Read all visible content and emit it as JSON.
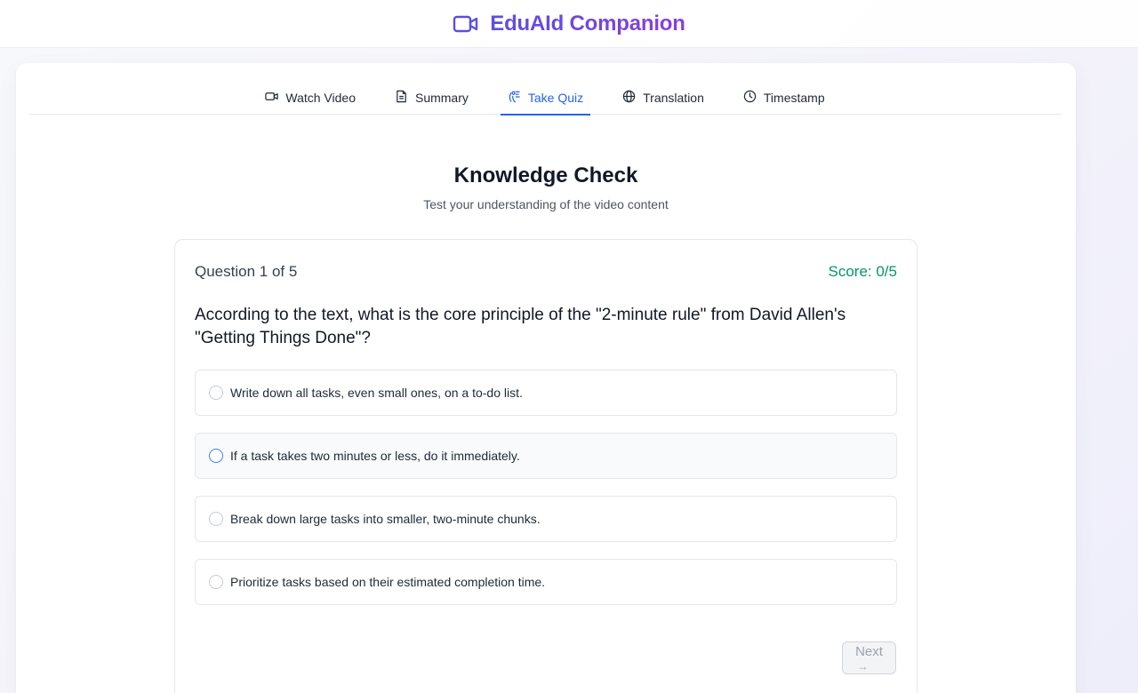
{
  "app": {
    "title": "EduAId Companion",
    "brand_icon": "video-camera-icon",
    "accent": "#2563eb",
    "brand_gradient": [
      "#5b4fe0",
      "#8b3fd9"
    ]
  },
  "tabs": [
    {
      "label": "Watch Video",
      "icon": "video-icon",
      "active": false
    },
    {
      "label": "Summary",
      "icon": "document-icon",
      "active": false
    },
    {
      "label": "Take Quiz",
      "icon": "quiz-icon",
      "active": true
    },
    {
      "label": "Translation",
      "icon": "globe-icon",
      "active": false
    },
    {
      "label": "Timestamp",
      "icon": "clock-icon",
      "active": false
    }
  ],
  "quiz": {
    "heading": "Knowledge Check",
    "subheading": "Test your understanding of the video content",
    "question_counter": "Question 1 of 5",
    "score": "Score: 0/5",
    "question": "According to the text, what is the core principle of the \"2-minute rule\" from David Allen's \"Getting Things Done\"?",
    "options": [
      "Write down all tasks, even small ones, on a to-do list.",
      "If a task takes two minutes or less, do it immediately.",
      "Break down large tasks into smaller, two-minute chunks.",
      "Prioritize tasks based on their estimated completion time."
    ],
    "next_label": "Next",
    "next_arrow": "→",
    "score_color": "#059669"
  }
}
